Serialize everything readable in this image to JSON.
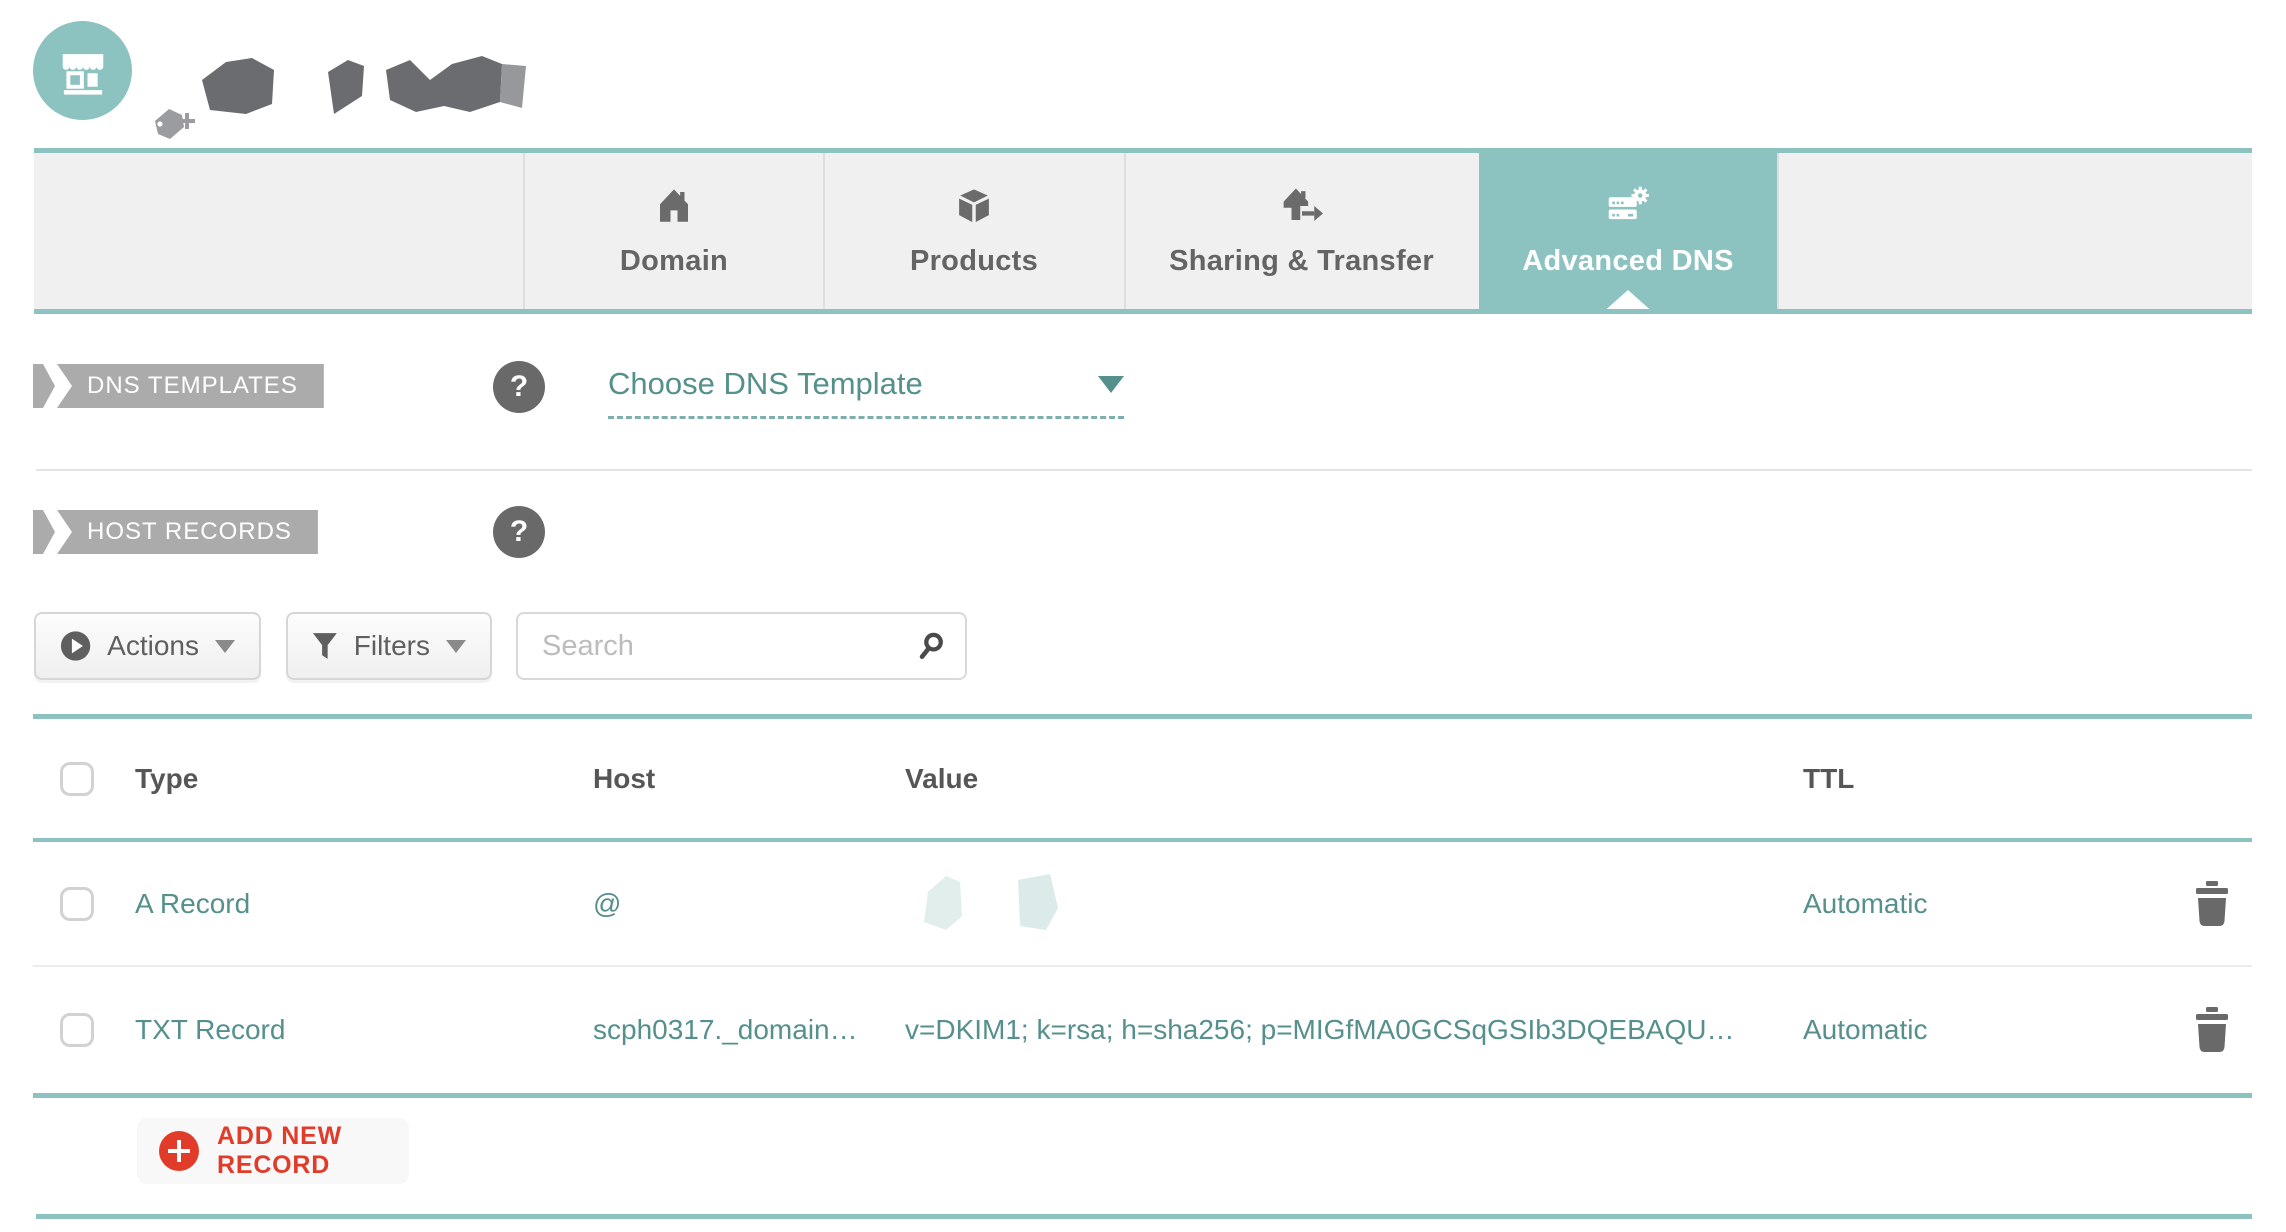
{
  "colors": {
    "accent_teal": "#8cc2c0",
    "teal_text": "#55908d",
    "badge_gray": "#ababab",
    "action_red": "#e13b2a"
  },
  "tabs": [
    {
      "label": "Domain"
    },
    {
      "label": "Products"
    },
    {
      "label": "Sharing & Transfer"
    },
    {
      "label": "Advanced DNS"
    }
  ],
  "active_tab": "Advanced DNS",
  "dns_templates": {
    "badge": "DNS TEMPLATES",
    "help": "?",
    "dropdown": "Choose DNS Template"
  },
  "host_records": {
    "badge": "HOST RECORDS",
    "help": "?"
  },
  "toolbar": {
    "actions": "Actions",
    "filters": "Filters",
    "search_placeholder": "Search"
  },
  "table": {
    "headers": {
      "type": "Type",
      "host": "Host",
      "value": "Value",
      "ttl": "TTL"
    },
    "rows": [
      {
        "type": "A Record",
        "host": "@",
        "value": "",
        "ttl": "Automatic"
      },
      {
        "type": "TXT Record",
        "host": "scph0317._domain…",
        "value": "v=DKIM1; k=rsa; h=sha256; p=MIGfMA0GCSqGSIb3DQEBAQU…",
        "ttl": "Automatic"
      }
    ]
  },
  "footer": {
    "add_record": "ADD NEW RECORD"
  }
}
